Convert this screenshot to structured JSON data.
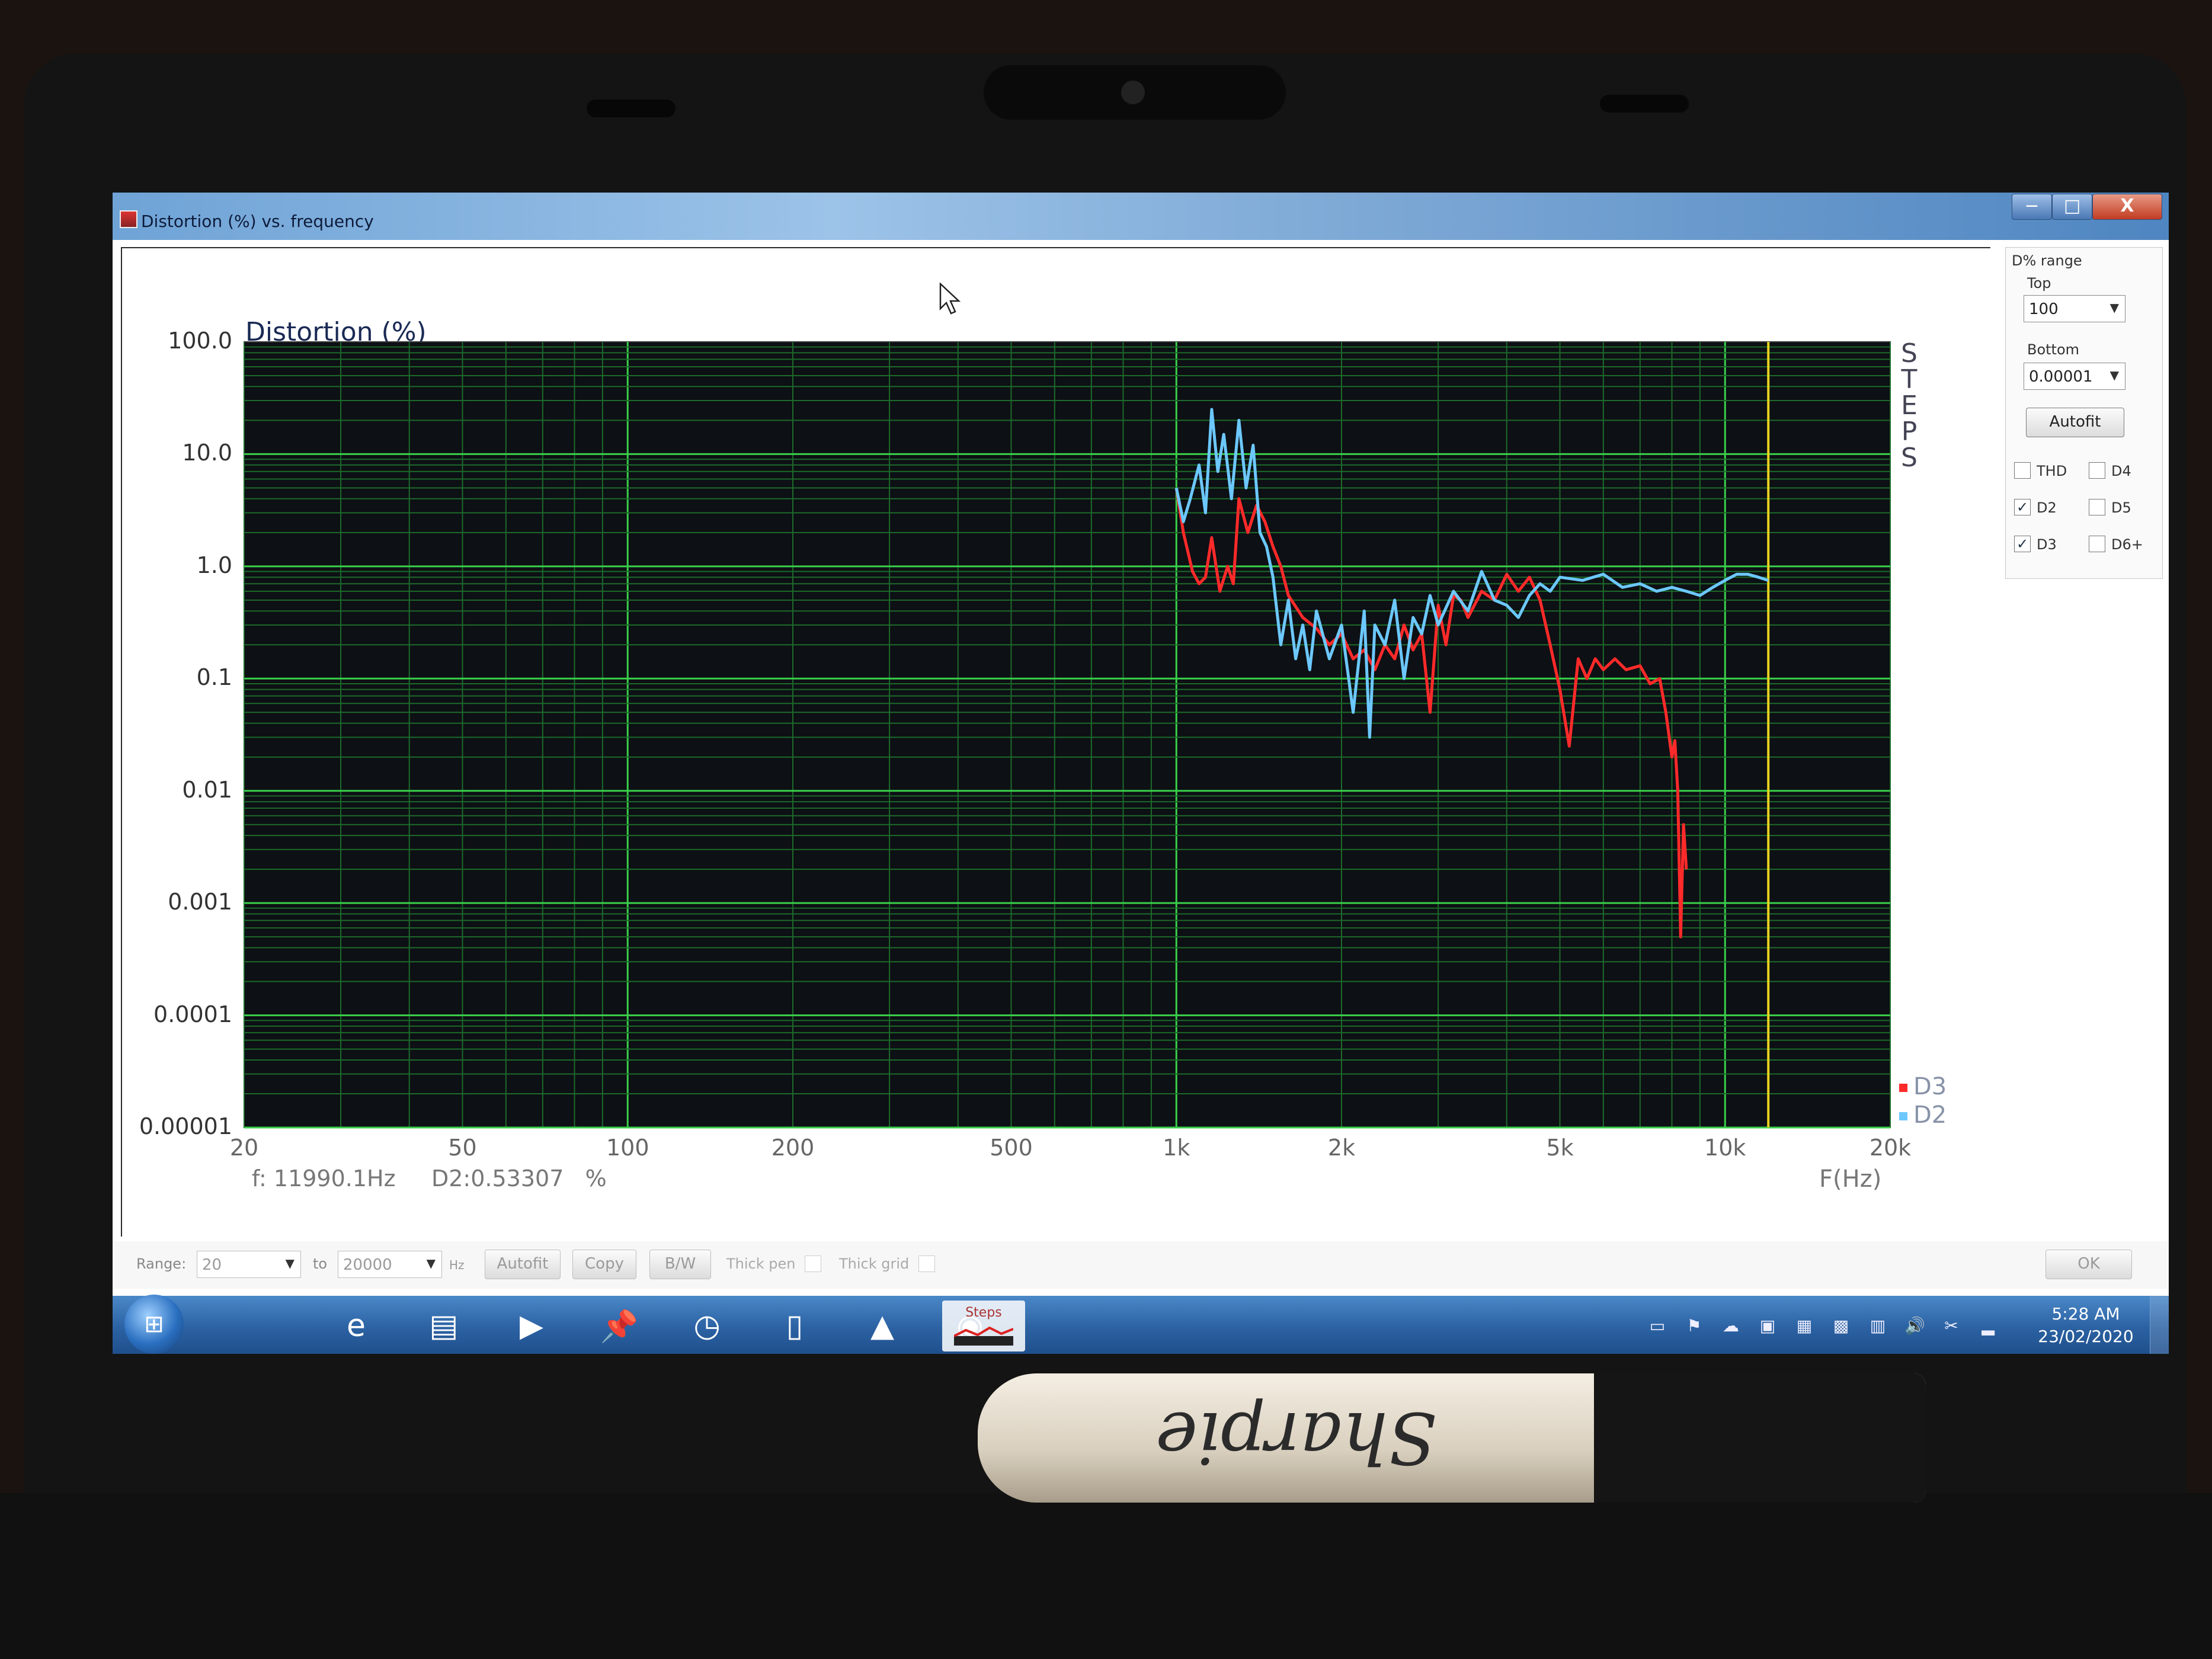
{
  "window": {
    "title": "Distortion (%) vs. frequency",
    "minimize_glyph": "−",
    "maximize_glyph": "□",
    "close_glyph": "X"
  },
  "icons": {
    "app": "distortion-app-icon",
    "minimize": "minimize-icon",
    "maximize": "restore-icon",
    "close": "close-icon",
    "cursor": "mouse-pointer-icon"
  },
  "chart_data": {
    "type": "line",
    "title": "Distortion (%)",
    "xlabel": "F(Hz)",
    "ylabel": "",
    "x_scale": "log",
    "y_scale": "log",
    "xlim": [
      20,
      20000
    ],
    "ylim": [
      1e-05,
      100
    ],
    "x_ticks": [
      {
        "value": 20,
        "label": "20"
      },
      {
        "value": 50,
        "label": "50"
      },
      {
        "value": 100,
        "label": "100"
      },
      {
        "value": 200,
        "label": "200"
      },
      {
        "value": 500,
        "label": "500"
      },
      {
        "value": 1000,
        "label": "1k"
      },
      {
        "value": 2000,
        "label": "2k"
      },
      {
        "value": 5000,
        "label": "5k"
      },
      {
        "value": 10000,
        "label": "10k"
      },
      {
        "value": 20000,
        "label": "20k"
      }
    ],
    "y_ticks": [
      {
        "value": 100,
        "label": "100.0"
      },
      {
        "value": 10,
        "label": "10.0"
      },
      {
        "value": 1,
        "label": "1.0"
      },
      {
        "value": 0.1,
        "label": "0.1"
      },
      {
        "value": 0.01,
        "label": "0.01"
      },
      {
        "value": 0.001,
        "label": "0.001"
      },
      {
        "value": 0.0001,
        "label": "0.0001"
      },
      {
        "value": 1e-05,
        "label": "0.00001"
      }
    ],
    "grid": true,
    "marker_frequency": 11990.1,
    "legend_position": "bottom-right",
    "series": [
      {
        "name": "D3",
        "color": "#ff2a2a",
        "x": [
          1000,
          1030,
          1070,
          1100,
          1130,
          1160,
          1200,
          1240,
          1270,
          1300,
          1350,
          1400,
          1450,
          1500,
          1550,
          1600,
          1700,
          1800,
          1900,
          2000,
          2100,
          2200,
          2300,
          2400,
          2500,
          2600,
          2700,
          2800,
          2900,
          3000,
          3100,
          3200,
          3300,
          3400,
          3600,
          3800,
          4000,
          4200,
          4400,
          4600,
          4800,
          5000,
          5200,
          5400,
          5600,
          5800,
          6000,
          6300,
          6600,
          7000,
          7300,
          7600,
          7800,
          8000,
          8100,
          8200,
          8300,
          8400,
          8500
        ],
        "y": [
          5,
          2,
          0.9,
          0.7,
          0.8,
          1.8,
          0.6,
          1.0,
          0.7,
          4.0,
          2.0,
          3.5,
          2.5,
          1.5,
          1.0,
          0.55,
          0.35,
          0.28,
          0.2,
          0.25,
          0.15,
          0.18,
          0.12,
          0.2,
          0.15,
          0.3,
          0.18,
          0.25,
          0.05,
          0.45,
          0.2,
          0.55,
          0.5,
          0.35,
          0.6,
          0.5,
          0.85,
          0.6,
          0.8,
          0.5,
          0.2,
          0.08,
          0.025,
          0.15,
          0.1,
          0.15,
          0.12,
          0.15,
          0.12,
          0.13,
          0.09,
          0.1,
          0.05,
          0.02,
          0.028,
          0.01,
          0.0005,
          0.005,
          0.002
        ]
      },
      {
        "name": "D2",
        "color": "#6cc8ff",
        "x": [
          1000,
          1030,
          1060,
          1100,
          1130,
          1160,
          1190,
          1220,
          1260,
          1300,
          1340,
          1380,
          1420,
          1460,
          1500,
          1550,
          1600,
          1650,
          1700,
          1750,
          1800,
          1900,
          2000,
          2100,
          2200,
          2250,
          2300,
          2400,
          2500,
          2600,
          2700,
          2800,
          2900,
          3000,
          3200,
          3400,
          3600,
          3800,
          4000,
          4200,
          4400,
          4600,
          4800,
          5000,
          5500,
          6000,
          6500,
          7000,
          7500,
          8000,
          8500,
          9000,
          9500,
          10000,
          10500,
          11000,
          11500,
          11990
        ],
        "y": [
          5,
          2.5,
          4,
          8,
          3,
          25,
          7,
          15,
          4,
          20,
          5,
          12,
          2,
          1.5,
          0.8,
          0.2,
          0.5,
          0.15,
          0.3,
          0.12,
          0.4,
          0.15,
          0.3,
          0.05,
          0.4,
          0.03,
          0.3,
          0.2,
          0.5,
          0.1,
          0.35,
          0.25,
          0.55,
          0.3,
          0.6,
          0.4,
          0.9,
          0.5,
          0.45,
          0.35,
          0.55,
          0.7,
          0.6,
          0.8,
          0.75,
          0.85,
          0.65,
          0.7,
          0.6,
          0.65,
          0.6,
          0.55,
          0.65,
          0.75,
          0.85,
          0.85,
          0.8,
          0.75
        ]
      }
    ]
  },
  "plot": {
    "steps_label": [
      "S",
      "T",
      "E",
      "P",
      "S"
    ],
    "readout_freq": "f: 11990.1Hz",
    "readout_value": "D2:0.53307   %",
    "legend": [
      {
        "label": "D3",
        "color": "#ff2a2a"
      },
      {
        "label": "D2",
        "color": "#6cc8ff"
      }
    ]
  },
  "side_panel": {
    "group_title": "D% range",
    "top_label": "Top",
    "top_value": "100",
    "bottom_label": "Bottom",
    "bottom_value": "0.00001",
    "autofit_label": "Autofit",
    "checkboxes": [
      {
        "label": "THD",
        "checked": false
      },
      {
        "label": "D4",
        "checked": false
      },
      {
        "label": "D2",
        "checked": true
      },
      {
        "label": "D5",
        "checked": false
      },
      {
        "label": "D3",
        "checked": true
      },
      {
        "label": "D6+",
        "checked": false
      }
    ],
    "check_glyph": "✓"
  },
  "bottom_controls": {
    "range_label": "Range:",
    "range_from": "20",
    "to_label": "to",
    "range_to": "20000",
    "unit_label": "Hz",
    "autofit_label": "Autofit",
    "copy_label": "Copy",
    "bw_label": "B/W",
    "thick_pen_label": "Thick pen",
    "thick_grid_label": "Thick grid",
    "ok_label": "OK",
    "dropdown_glyph": "▼"
  },
  "taskbar": {
    "apps": [
      {
        "name": "internet-explorer-icon",
        "glyph": "e"
      },
      {
        "name": "file-explorer-icon",
        "glyph": "▤"
      },
      {
        "name": "media-player-icon",
        "glyph": "▶"
      },
      {
        "name": "pin-icon",
        "glyph": "📌"
      },
      {
        "name": "clock-app-icon",
        "glyph": "◷"
      },
      {
        "name": "blank-document-icon",
        "glyph": "▯"
      },
      {
        "name": "vlc-cone-icon",
        "glyph": "▲"
      },
      {
        "name": "chrome-icon",
        "glyph": "◉"
      }
    ],
    "steps_label": "Steps",
    "tray": [
      "▭",
      "⚑",
      "☁",
      "▣",
      "▦",
      "▩",
      "▥",
      "🔊",
      "✂",
      "▂"
    ],
    "time": "5:28 AM",
    "date": "23/02/2020"
  },
  "photo": {
    "marker_brand": "Sharpie"
  }
}
